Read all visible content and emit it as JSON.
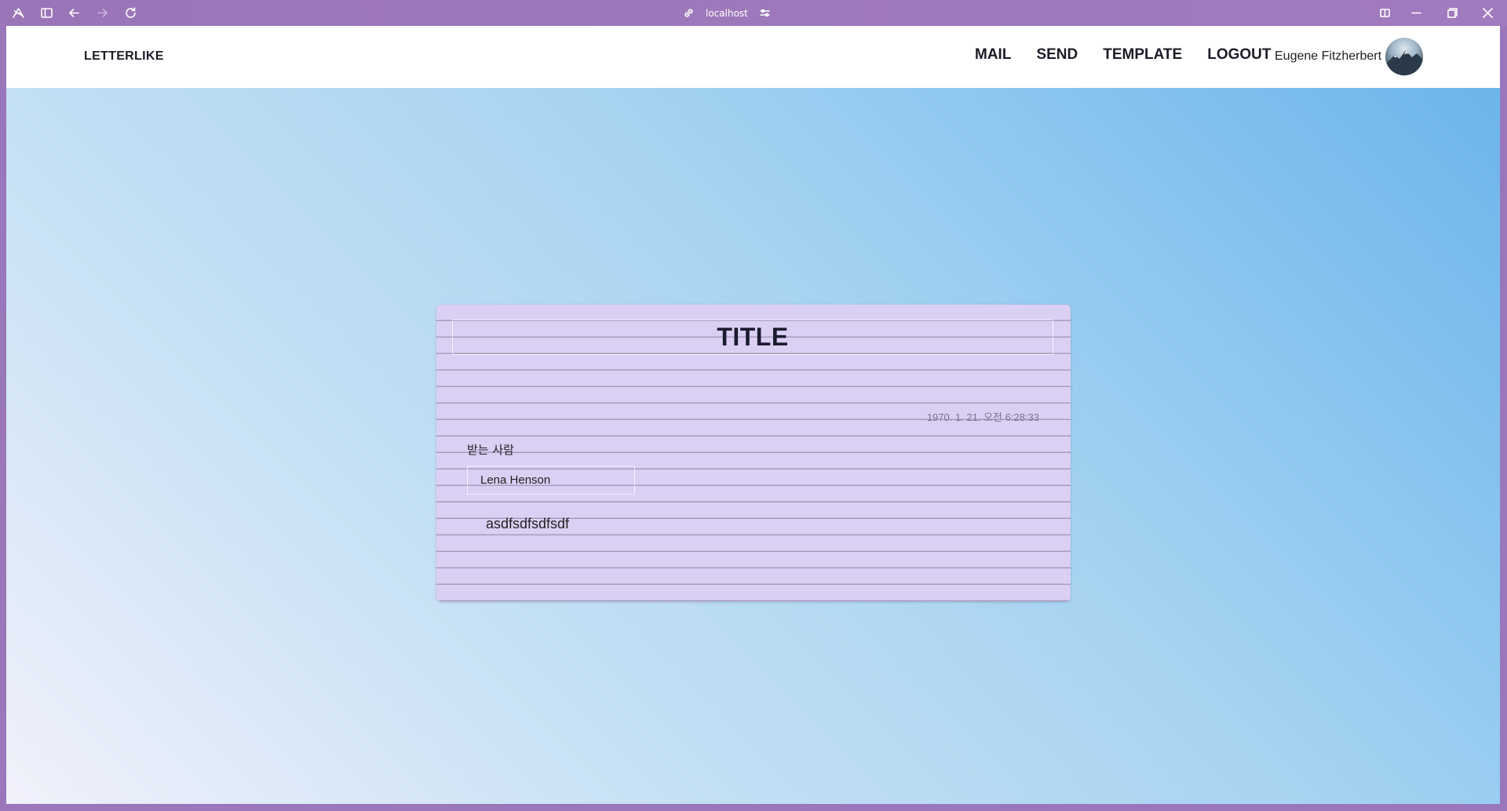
{
  "browser": {
    "url": "localhost"
  },
  "header": {
    "brand": "LETTERLIKE",
    "nav": [
      {
        "label": "MAIL"
      },
      {
        "label": "SEND"
      },
      {
        "label": "TEMPLATE"
      },
      {
        "label": "LOGOUT"
      }
    ],
    "user_name": "Eugene Fitzherbert"
  },
  "letter": {
    "title": "TITLE",
    "date": "1970. 1. 21. 오전 6:28:33",
    "recipient_label": "받는 사람",
    "recipient_value": "Lena Henson",
    "body": "asdfsdfsdfsdf"
  },
  "colors": {
    "chrome": "#9a77ba",
    "letter_bg": "#dbd0f4",
    "gradient_start": "#67b3ec",
    "gradient_end": "#f1f1fb"
  }
}
